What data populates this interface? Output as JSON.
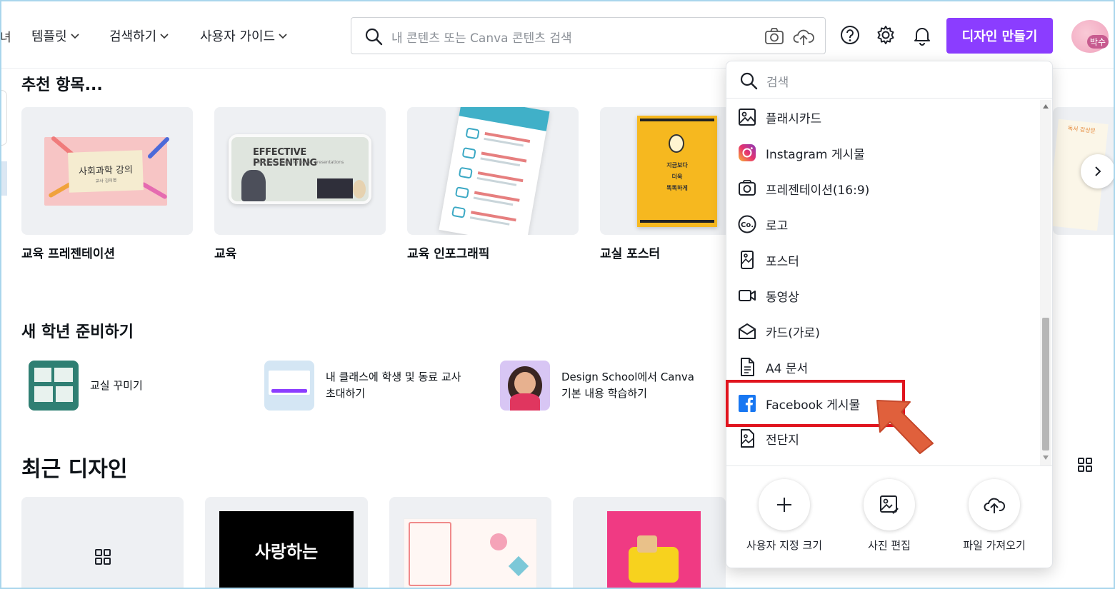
{
  "header": {
    "edge_text": "녀",
    "nav": [
      {
        "label": "템플릿"
      },
      {
        "label": "검색하기"
      },
      {
        "label": "사용자 가이드"
      }
    ],
    "search_placeholder": "내 콘텐츠 또는 Canva 콘텐츠 검색",
    "create_button": "디자인 만들기",
    "avatar_label": "박수"
  },
  "recommended": {
    "title": "추천 항목...",
    "cards": [
      {
        "label": "교육 프레젠테이션",
        "thumb_title": "사회과학 강의",
        "thumb_sub": "교사 김미영"
      },
      {
        "label": "교육",
        "thumb_title": "EFFECTIVE PRESENTING",
        "thumb_sub": "Use these steps for better presentations"
      },
      {
        "label": "교육 인포그래픽"
      },
      {
        "label": "교실 포스터",
        "thumb_lines": [
          "지금보다",
          "더욱",
          "똑똑하게"
        ]
      }
    ],
    "partial_card_text": "독서 감상문"
  },
  "back_to_school": {
    "title": "새 학년 준비하기",
    "items": [
      {
        "label": "교실 꾸미기"
      },
      {
        "label_line1": "내 클래스에 학생 및 동료 교사",
        "label_line2": "초대하기"
      },
      {
        "label_line1": "Design School에서 Canva",
        "label_line2": "기본 내용 학습하기"
      }
    ]
  },
  "recent": {
    "title": "최근 디자인",
    "thumb_text": "사랑하는"
  },
  "dropdown": {
    "search_placeholder": "검색",
    "items": [
      {
        "label": "플래시카드",
        "icon": "image-icon"
      },
      {
        "label": "Instagram 게시물",
        "icon": "instagram-icon"
      },
      {
        "label": "프레젠테이션(16:9)",
        "icon": "presentation-icon"
      },
      {
        "label": "로고",
        "icon": "logo-co-icon"
      },
      {
        "label": "포스터",
        "icon": "poster-icon"
      },
      {
        "label": "동영상",
        "icon": "video-icon"
      },
      {
        "label": "카드(가로)",
        "icon": "envelope-icon"
      },
      {
        "label": "A4 문서",
        "icon": "document-icon"
      },
      {
        "label": "Facebook 게시물",
        "icon": "facebook-icon"
      },
      {
        "label": "전단지",
        "icon": "flyer-icon"
      }
    ],
    "actions": [
      {
        "label": "사용자 지정 크기",
        "icon": "plus-icon"
      },
      {
        "label": "사진 편집",
        "icon": "photo-edit-icon"
      },
      {
        "label": "파일 가져오기",
        "icon": "upload-cloud-icon"
      }
    ]
  },
  "colors": {
    "accent": "#8b3dff",
    "highlight": "#e0141e",
    "arrow": "#e0603c"
  }
}
